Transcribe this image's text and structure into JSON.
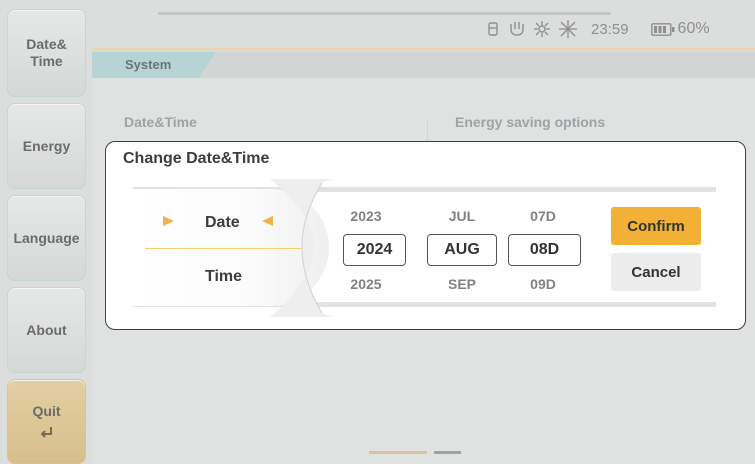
{
  "sidebar": {
    "items": [
      {
        "label": "Date&\nTime"
      },
      {
        "label": "Energy"
      },
      {
        "label": "Language"
      },
      {
        "label": "About"
      },
      {
        "label": "Quit"
      }
    ]
  },
  "status_bar": {
    "time": "23:59",
    "battery": "60%"
  },
  "tab": {
    "label": "System"
  },
  "sections": {
    "left": "Date&Time",
    "right": "Energy saving options"
  },
  "dialog": {
    "title": "Change Date&Time",
    "modes": {
      "date": "Date",
      "time": "Time",
      "selected": "Date"
    },
    "picker": {
      "year": {
        "prev": "2023",
        "current": "2024",
        "next": "2025"
      },
      "month": {
        "prev": "JUL",
        "current": "AUG",
        "next": "SEP"
      },
      "day": {
        "prev": "07D",
        "current": "08D",
        "next": "09D"
      }
    },
    "confirm_label": "Confirm",
    "cancel_label": "Cancel"
  },
  "colors": {
    "accent": "#f2b136",
    "tab": "#b6d4d4",
    "quit": "#d7bf8c"
  },
  "icons": [
    "lock-icon",
    "usb-plug-icon",
    "network-icon",
    "sun-icon",
    "battery-icon",
    "return-icon"
  ],
  "pager": {
    "pages": 2,
    "current": 1
  }
}
